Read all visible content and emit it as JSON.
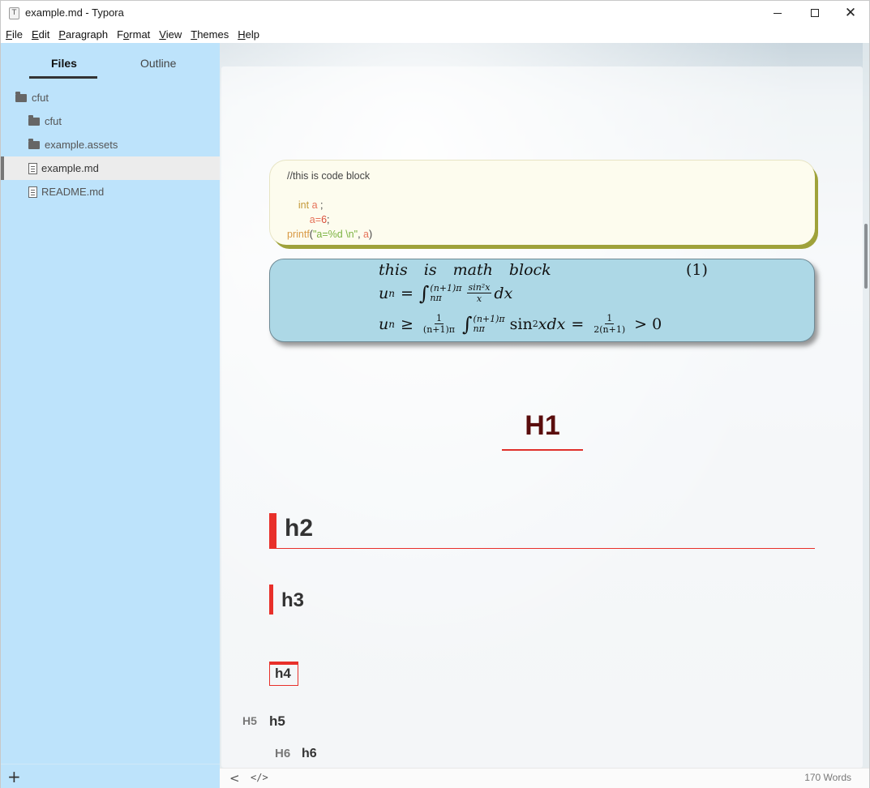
{
  "window": {
    "title": "example.md - Typora",
    "app_icon_glyph": "T"
  },
  "menubar": [
    {
      "mnemonic": "F",
      "rest": "ile"
    },
    {
      "mnemonic": "E",
      "rest": "dit"
    },
    {
      "mnemonic": "P",
      "rest": "aragraph"
    },
    {
      "pre": "F",
      "mnemonic": "o",
      "rest": "rmat"
    },
    {
      "mnemonic": "V",
      "rest": "iew"
    },
    {
      "mnemonic": "T",
      "rest": "hemes"
    },
    {
      "mnemonic": "H",
      "rest": "elp"
    }
  ],
  "sidebar": {
    "tabs": {
      "files": "Files",
      "outline": "Outline"
    },
    "active_tab": "files",
    "tree": [
      {
        "label": "cfut",
        "type": "folder",
        "level": 0
      },
      {
        "label": "cfut",
        "type": "folder",
        "level": 1
      },
      {
        "label": "example.assets",
        "type": "folder",
        "level": 1
      },
      {
        "label": "example.md",
        "type": "file",
        "level": 1,
        "active": true
      },
      {
        "label": "README.md",
        "type": "file",
        "level": 1
      }
    ],
    "add_glyph": "+"
  },
  "code_block": {
    "comment": "//this is code block",
    "kw_int": "int",
    "var_a": "a",
    "semi": ";",
    "assign_var": "a",
    "assign_eq": "=",
    "assign_num": "6",
    "fn": "printf",
    "paren_open": "(",
    "str": "\"a=%d \\n\"",
    "comma": ", ",
    "arg": "a",
    "paren_close": ")",
    "background": "#fdfcee",
    "shadow_color": "#9fa23a"
  },
  "math_block": {
    "line1": "this is math block",
    "eq_number": "(1)",
    "u": "u",
    "n": "n",
    "eq": "=",
    "geq": "≥",
    "int_sym": "∫",
    "upper": "(n+1)π",
    "lower": "nπ",
    "frac1_num": "sin²x",
    "frac1_den": "x",
    "dx": "dx",
    "frac2_num": "1",
    "frac2_den": "(n+1)π",
    "sin2": "sin",
    "sup2": "2",
    "xdx": "xdx",
    "frac3_num": "1",
    "frac3_den": "2(n+1)",
    "gt0": "> 0",
    "background": "#add8e6"
  },
  "headings": {
    "h1": "H1",
    "h2": "h2",
    "h3": "h3",
    "h4": "h4",
    "h5_tag": "H5",
    "h5": "h5",
    "h6_tag": "H6",
    "h6": "h6",
    "accent_color": "#e8302a",
    "h1_color": "#5a0d0d"
  },
  "statusbar": {
    "back_glyph": "<",
    "source_glyph": "</>",
    "word_count": "170 Words"
  },
  "icons": {
    "folder": "folder-icon",
    "file": "file-icon",
    "minimize": "minimize-icon",
    "maximize": "maximize-icon",
    "close": "close-icon"
  }
}
